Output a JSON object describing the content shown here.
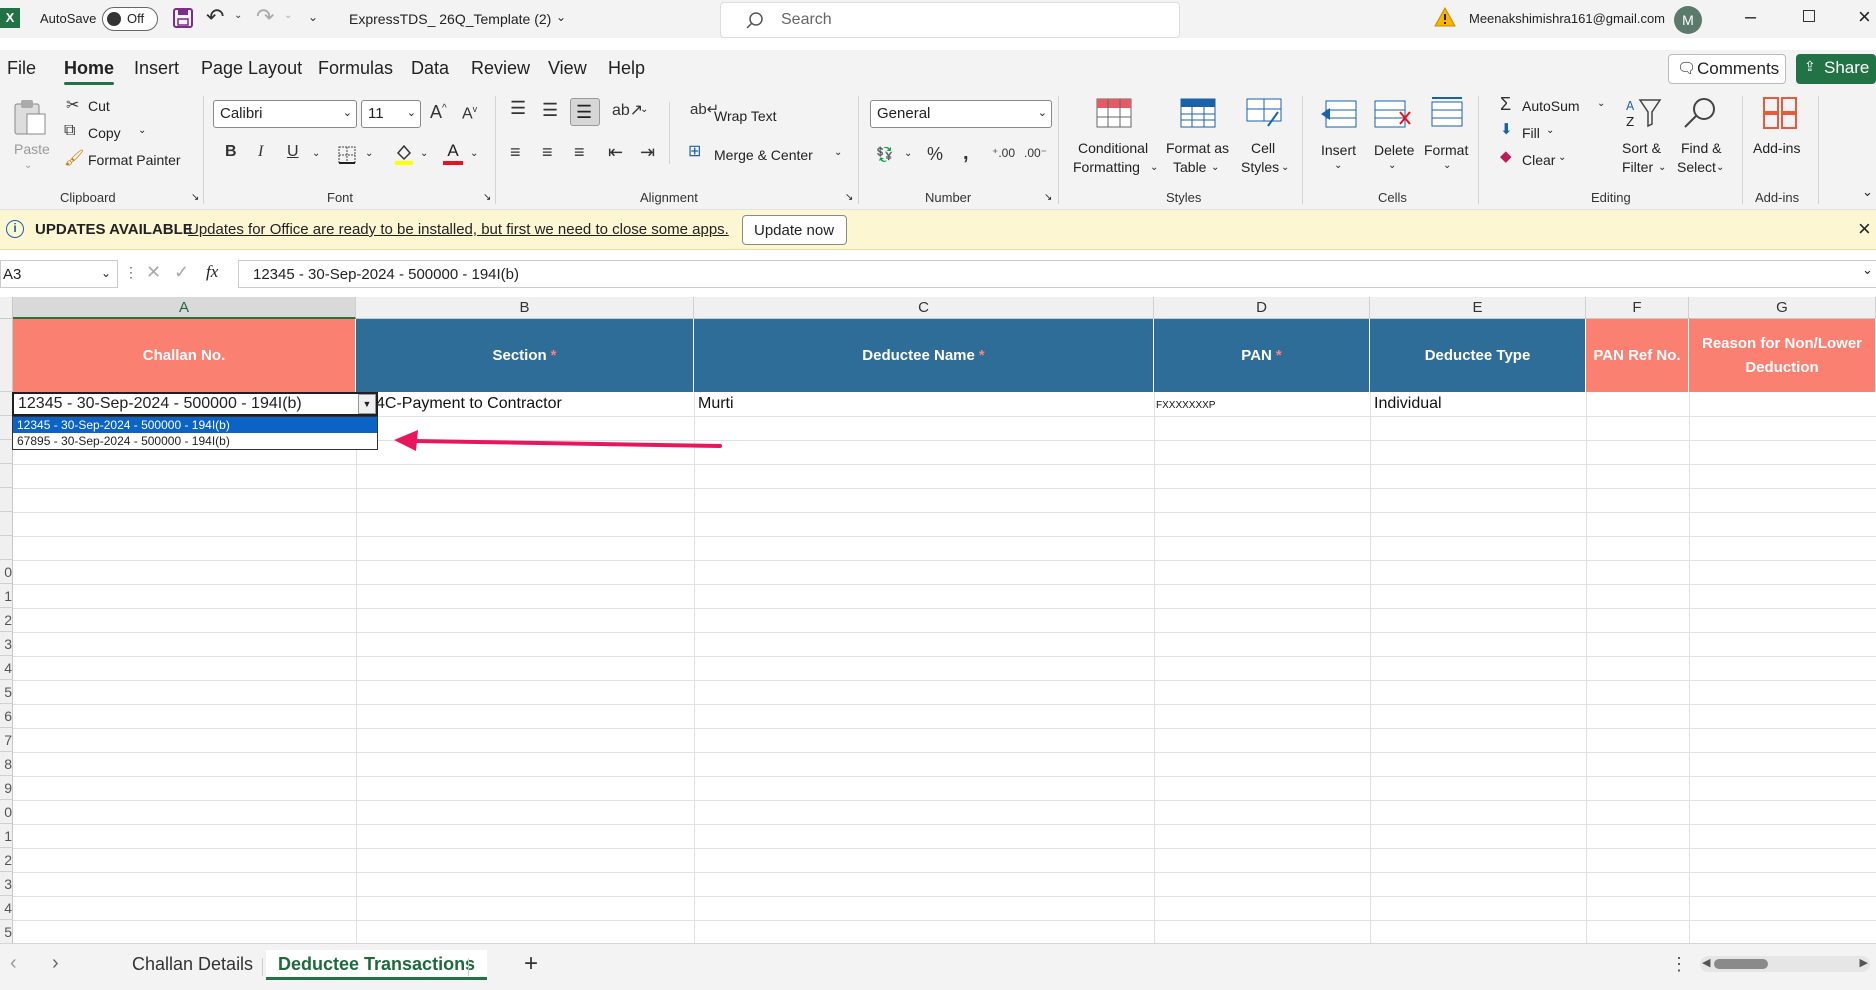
{
  "titlebar": {
    "autosave_label": "AutoSave",
    "autosave_state": "Off",
    "file_name": "ExpressTDS_ 26Q_Template (2)",
    "search_placeholder": "Search",
    "user_email": "Meenakshimishra161@gmail.com",
    "avatar_initial": "M"
  },
  "menu": {
    "tabs": [
      "File",
      "Home",
      "Insert",
      "Page Layout",
      "Formulas",
      "Data",
      "Review",
      "View",
      "Help"
    ],
    "active_tab": "Home",
    "comments_label": "Comments",
    "share_label": "Share"
  },
  "ribbon": {
    "clipboard": {
      "paste": "Paste",
      "cut": "Cut",
      "copy": "Copy",
      "format_painter": "Format Painter",
      "group": "Clipboard"
    },
    "font": {
      "name": "Calibri",
      "size": "11",
      "group": "Font",
      "bold": "B",
      "italic": "I",
      "underline": "U"
    },
    "alignment": {
      "wrap_text": "Wrap Text",
      "merge_center": "Merge & Center",
      "group": "Alignment"
    },
    "number": {
      "format": "General",
      "group": "Number"
    },
    "styles": {
      "conditional_l1": "Conditional",
      "conditional_l2": "Formatting",
      "format_table_l1": "Format as",
      "format_table_l2": "Table",
      "cell_styles_l1": "Cell",
      "cell_styles_l2": "Styles",
      "group": "Styles"
    },
    "cells": {
      "insert": "Insert",
      "delete": "Delete",
      "format": "Format",
      "group": "Cells"
    },
    "editing": {
      "autosum": "AutoSum",
      "fill": "Fill",
      "clear": "Clear",
      "sort_l1": "Sort &",
      "sort_l2": "Filter",
      "find_l1": "Find &",
      "find_l2": "Select",
      "group": "Editing"
    },
    "addins": {
      "addins": "Add-ins",
      "group": "Add-ins"
    }
  },
  "updatebar": {
    "title": "UPDATES AVAILABLE",
    "message": "Updates for Office are ready to be installed, but first we need to close some apps.",
    "button": "Update now"
  },
  "formulabar": {
    "name_box": "A3",
    "fx": "fx",
    "content": "12345 - 30-Sep-2024 - 500000 - 194I(b)"
  },
  "grid": {
    "columns": [
      "A",
      "B",
      "C",
      "D",
      "E",
      "F",
      "G"
    ],
    "headers": {
      "a": "Challan No.",
      "b": "Section",
      "c": "Deductee Name",
      "d": "PAN",
      "e": "Deductee Type",
      "f": "PAN Ref No.",
      "g_l1": "Reason for Non/Lower",
      "g_l2": "Deduction",
      "required_mark": "*"
    },
    "row3": {
      "challan": "12345 - 30-Sep-2024 - 500000 - 194I(b)",
      "section": "4C-Payment to Contractor",
      "name": "Murti",
      "pan": "FXXXXXXXP",
      "type": "Individual"
    },
    "row_numbers": [
      "",
      "",
      "",
      "",
      "",
      "",
      "",
      "0",
      "1",
      "2",
      "3",
      "4",
      "5",
      "6",
      "7",
      "8",
      "9",
      "0",
      "1",
      "2",
      "3",
      "4",
      "5"
    ],
    "dropdown_options": [
      "12345 - 30-Sep-2024 - 500000 - 194I(b)",
      "67895 - 30-Sep-2024 - 500000 - 194I(b)"
    ]
  },
  "sheets": {
    "tabs": [
      "Challan Details",
      "Deductee Transactions"
    ],
    "active": "Deductee Transactions",
    "add": "+"
  },
  "colors": {
    "excel_green": "#217346",
    "salmon_header": "#fa8072",
    "blue_header": "#2e6d97",
    "annotation_arrow": "#e8175d",
    "dropdown_selected": "#0b63c5"
  }
}
